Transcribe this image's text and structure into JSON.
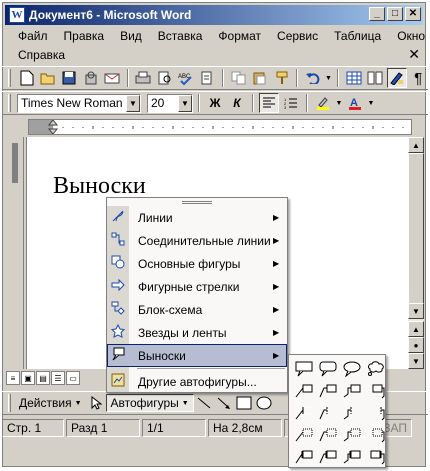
{
  "window": {
    "title": "Документ6 - Microsoft Word",
    "app_letter": "W"
  },
  "window_buttons": {
    "minimize": "_",
    "maximize": "□",
    "close": "✕"
  },
  "menubar": {
    "row1": [
      "Файл",
      "Правка",
      "Вид",
      "Вставка",
      "Формат",
      "Сервис",
      "Таблица",
      "Окно"
    ],
    "row2": [
      "Справка"
    ],
    "close_doc": "✕"
  },
  "toolbar_font": {
    "font_name": "Times New Roman",
    "font_size": "20"
  },
  "document": {
    "text": "Выноски"
  },
  "autoshapes_menu": {
    "items": [
      {
        "label": "Линии",
        "icon": "lines-icon"
      },
      {
        "label": "Соединительные линии",
        "icon": "connectors-icon"
      },
      {
        "label": "Основные фигуры",
        "icon": "basic-shapes-icon"
      },
      {
        "label": "Фигурные стрелки",
        "icon": "block-arrows-icon"
      },
      {
        "label": "Блок-схема",
        "icon": "flowchart-icon"
      },
      {
        "label": "Звезды и ленты",
        "icon": "stars-banners-icon"
      },
      {
        "label": "Выноски",
        "icon": "callouts-icon",
        "highlighted": true
      },
      {
        "label": "Другие автофигуры...",
        "icon": "more-autoshapes-icon"
      }
    ]
  },
  "drawing_toolbar": {
    "actions_label": "Действия",
    "autoshapes_label": "Автофигуры"
  },
  "statusbar": {
    "page": "Стр. 1",
    "section": "Разд 1",
    "pages": "1/1",
    "position": "На 2,8см",
    "line": "Ст",
    "ovr": "ЗАП"
  },
  "colors": {
    "title_start": "#0a246a",
    "title_end": "#a6caf0",
    "menu_highlight": "#b6bdd2",
    "chrome": "#d4d0c8"
  }
}
